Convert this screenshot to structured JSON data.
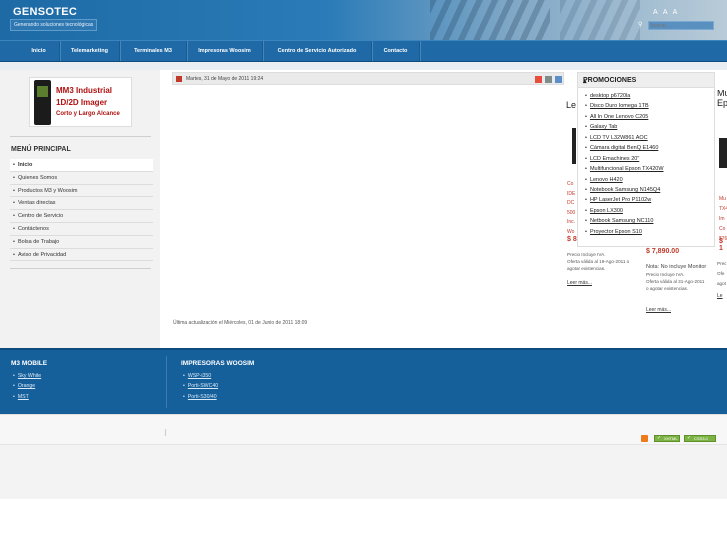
{
  "header": {
    "logo": "GENSOTEC",
    "slogan": "Generando soluciones tecnológicas",
    "font_size_controls": "A A A",
    "search_placeholder": "buscar..."
  },
  "nav": {
    "items": [
      "Inicio",
      "Telemarketing",
      "Terminales M3",
      "Impresoras Woosim",
      "Centro de Servicio Autorizado",
      "Contacto"
    ]
  },
  "sidebar": {
    "banner": {
      "line1": "MM3 Industrial",
      "line2": "1D/2D Imager",
      "line3": "Corto y Largo Alcance"
    },
    "menu_title": "MENÚ PRINCIPAL",
    "menu_items": [
      "Inicio",
      "Quienes Somos",
      "Productos M3 y Woosim",
      "Ventas directas",
      "Centro de Servicio",
      "Contáctenos",
      "Bolsa de Trabajo",
      "Aviso de Privacidad"
    ]
  },
  "article": {
    "date": "Martes, 31 de Mayo de 2011 19:24",
    "last_update": "Última actualización el Miércoles, 01 de Junio de 2011 18:09"
  },
  "promociones": {
    "title": "PROMOCIONES",
    "items": [
      "desktop p6720la",
      "Disco Duro Iomega 1TB",
      "All In One Lenovo C205",
      "Galaxy Tab",
      "LCD TV L32W861 AOC",
      "Cámara digital BenQ E1460",
      "LCD Emachines 20\"",
      "Multifuncional Epson TX420W",
      "Lenovo H420",
      "Notebook Samsung N145Q4",
      "HP LaserJet Pro P1102w",
      "Epson LX300",
      "Netbook Samsung NC110",
      "Proyector Epson S10"
    ]
  },
  "slides": {
    "left_title": "Le",
    "right_title_1": "Mu",
    "right_title_2": "Ep",
    "left_red": [
      "Co",
      "IDE",
      "DC",
      "500",
      "Inc.",
      "Wo"
    ],
    "left_price": "$ 8",
    "left_notes": [
      "Precio Incluye IVA.",
      "Oferta válida al 19-Ago-2011 o",
      "agotar existencias."
    ],
    "left_more": "Leer más...",
    "mid_price": "$ 7,890.00",
    "mid_notes": [
      "Nota: No incluye Monitor",
      "Precio Incluye IVA.",
      "Oferta válida al 31-Ago-2011",
      "o agotar existencias."
    ],
    "mid_more": "Leer más...",
    "right_red": [
      "Mu",
      "TX4",
      "Im",
      "Co",
      "$76"
    ],
    "right_price": "$ 1",
    "right_notes": [
      "Prec",
      "Ofe",
      "agot"
    ],
    "right_more": "Le"
  },
  "footer": {
    "col1": {
      "title": "M3 MOBILE",
      "links": [
        "Sky White",
        "Orange",
        "MST"
      ]
    },
    "col2": {
      "title": "IMPRESORAS WOOSIM",
      "links": [
        "WSP-i350",
        "Porti-SWC40",
        "Porti-S30/40"
      ]
    },
    "badges": [
      "XHTML",
      "CSS3.0"
    ]
  }
}
